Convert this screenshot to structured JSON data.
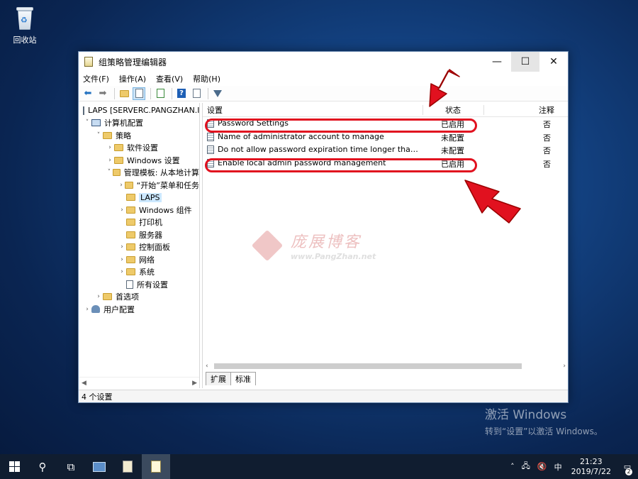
{
  "desktop": {
    "recycle_bin_label": "回收站",
    "activate_title": "激活 Windows",
    "activate_sub": "转到“设置”以激活 Windows。"
  },
  "window": {
    "title": "组策略管理编辑器",
    "menu": [
      "文件(F)",
      "操作(A)",
      "查看(V)",
      "帮助(H)"
    ],
    "tree": [
      {
        "label": "LAPS [SERVERC.PANGZHAN.I",
        "chev": "",
        "icon": "doc"
      },
      {
        "label": "计算机配置",
        "chev": "˅",
        "icon": "pc"
      },
      {
        "label": "策略",
        "chev": "˅",
        "icon": "folder"
      },
      {
        "label": "软件设置",
        "chev": "›",
        "icon": "folder"
      },
      {
        "label": "Windows 设置",
        "chev": "›",
        "icon": "folder"
      },
      {
        "label": "管理模板: 从本地计算",
        "chev": "˅",
        "icon": "folder"
      },
      {
        "label": "“开始”菜单和任务",
        "chev": "›",
        "icon": "folder"
      },
      {
        "label": "LAPS",
        "chev": "",
        "icon": "folder",
        "selected": true
      },
      {
        "label": "Windows 组件",
        "chev": "›",
        "icon": "folder"
      },
      {
        "label": "打印机",
        "chev": "",
        "icon": "folder"
      },
      {
        "label": "服务器",
        "chev": "",
        "icon": "folder"
      },
      {
        "label": "控制面板",
        "chev": "›",
        "icon": "folder"
      },
      {
        "label": "网络",
        "chev": "›",
        "icon": "folder"
      },
      {
        "label": "系统",
        "chev": "›",
        "icon": "folder"
      },
      {
        "label": "所有设置",
        "chev": "",
        "icon": "doc"
      },
      {
        "label": "首选项",
        "chev": "›",
        "icon": "folder"
      },
      {
        "label": "用户配置",
        "chev": "›",
        "icon": "user"
      }
    ],
    "columns": {
      "setting": "设置",
      "state": "状态",
      "comment": "注释"
    },
    "rows": [
      {
        "name": "Password Settings",
        "state": "已启用",
        "comment": "否"
      },
      {
        "name": "Name of administrator account to manage",
        "state": "未配置",
        "comment": "否"
      },
      {
        "name": "Do not allow password expiration time longer than re...",
        "state": "未配置",
        "comment": "否"
      },
      {
        "name": "Enable local admin password management",
        "state": "已启用",
        "comment": "否"
      }
    ],
    "tabs": [
      "扩展",
      "标准"
    ],
    "status": "4 个设置"
  },
  "watermark": {
    "line1": "庞展博客",
    "line2": "www.PangZhan.net"
  },
  "taskbar": {
    "tray_ime": "中",
    "time": "21:23",
    "date": "2019/7/22",
    "notif_count": "2"
  },
  "colors": {
    "highlight": "#e1111f",
    "taskbar": "#101d30"
  }
}
